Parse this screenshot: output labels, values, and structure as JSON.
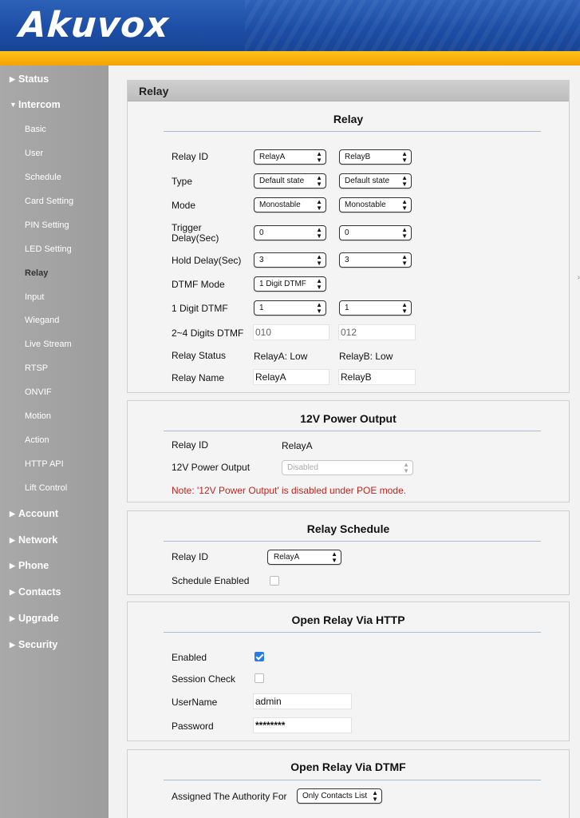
{
  "header": {
    "logo": "Akuvox"
  },
  "sidebar": {
    "status": "Status",
    "intercom": "Intercom",
    "intercom_items": [
      "Basic",
      "User",
      "Schedule",
      "Card Setting",
      "PIN Setting",
      "LED Setting",
      "Relay",
      "Input",
      "Wiegand",
      "Live Stream",
      "RTSP",
      "ONVIF",
      "Motion",
      "Action",
      "HTTP API",
      "Lift Control"
    ],
    "account": "Account",
    "network": "Network",
    "phone": "Phone",
    "contacts": "Contacts",
    "upgrade": "Upgrade",
    "security": "Security",
    "active_item": "Relay"
  },
  "page": {
    "title": "Relay"
  },
  "relay": {
    "title": "Relay",
    "labels": {
      "relay_id": "Relay ID",
      "type": "Type",
      "mode": "Mode",
      "trigger_delay": "Trigger Delay(Sec)",
      "hold_delay": "Hold Delay(Sec)",
      "dtmf_mode": "DTMF Mode",
      "one_digit_dtmf": "1 Digit DTMF",
      "multi_digit_dtmf": "2~4 Digits DTMF",
      "relay_status": "Relay Status",
      "relay_name": "Relay Name"
    },
    "a": {
      "relay_id": "RelayA",
      "type": "Default state",
      "mode": "Monostable",
      "trigger_delay": "0",
      "hold_delay": "3",
      "one_digit_dtmf": "1",
      "multi_digit_dtmf": "010",
      "status": "RelayA: Low",
      "name": "RelayA"
    },
    "b": {
      "relay_id": "RelayB",
      "type": "Default state",
      "mode": "Monostable",
      "trigger_delay": "0",
      "hold_delay": "3",
      "one_digit_dtmf": "1",
      "multi_digit_dtmf": "012",
      "status": "RelayB: Low",
      "name": "RelayB"
    },
    "dtmf_mode": "1 Digit DTMF"
  },
  "power": {
    "title": "12V Power Output",
    "relay_id_label": "Relay ID",
    "relay_id_value": "RelayA",
    "output_label": "12V Power Output",
    "output_value": "Disabled",
    "note": "Note: '12V Power Output' is disabled under POE mode."
  },
  "schedule": {
    "title": "Relay Schedule",
    "relay_id_label": "Relay ID",
    "relay_id_value": "RelayA",
    "enabled_label": "Schedule Enabled",
    "enabled": false
  },
  "http": {
    "title": "Open Relay Via HTTP",
    "enabled_label": "Enabled",
    "enabled": true,
    "session_label": "Session Check",
    "session_check": false,
    "username_label": "UserName",
    "username": "admin",
    "password_label": "Password",
    "password": "********"
  },
  "dtmf": {
    "title": "Open Relay Via DTMF",
    "authority_label": "Assigned The Authority For",
    "authority_value": "Only Contacts List"
  },
  "colors": {
    "header_blue": "#1d4ea6",
    "orange": "#f5a300",
    "sidebar": "#a3a3a3",
    "note_red": "#c0241c",
    "check_blue": "#2a7be4"
  }
}
